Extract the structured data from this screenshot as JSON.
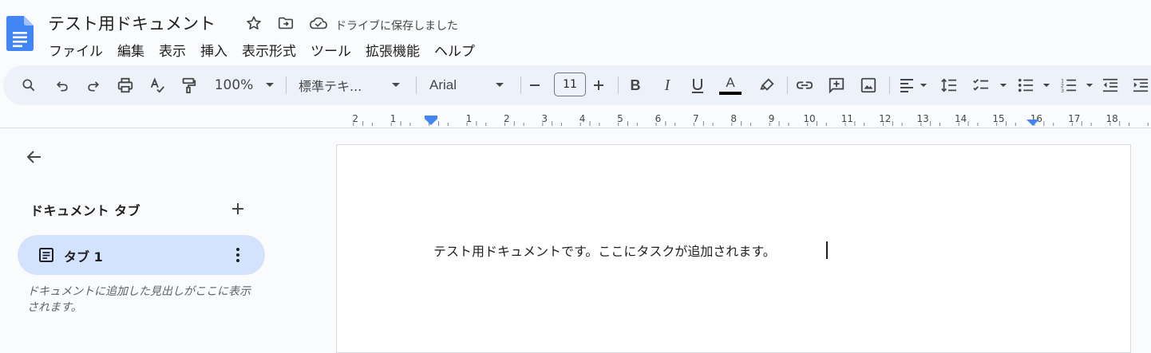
{
  "header": {
    "title": "テスト用ドキュメント",
    "save_status": "ドライブに保存しました",
    "menu": [
      "ファイル",
      "編集",
      "表示",
      "挿入",
      "表示形式",
      "ツール",
      "拡張機能",
      "ヘルプ"
    ]
  },
  "toolbar": {
    "zoom": "100%",
    "style": "標準テキ...",
    "font": "Arial",
    "font_size": "11",
    "icons": [
      "search-icon",
      "undo-icon",
      "redo-icon",
      "print-icon",
      "spellcheck-icon",
      "paint-format-icon",
      "bold-icon",
      "italic-icon",
      "underline-icon",
      "text-color-icon",
      "highlight-icon",
      "link-icon",
      "comment-icon",
      "image-icon",
      "align-left-icon",
      "line-spacing-icon",
      "checklist-icon",
      "bulleted-list-icon",
      "numbered-list-icon",
      "decrease-indent-icon",
      "increase-indent-icon"
    ],
    "colors": {
      "background": "#edf2fa",
      "text_color_bar": "#000000"
    }
  },
  "ruler": {
    "labels": [
      "2",
      "1",
      "1",
      "2",
      "3",
      "4",
      "5",
      "6",
      "7",
      "8",
      "9",
      "10",
      "11",
      "12",
      "13",
      "14",
      "15",
      "16",
      "17",
      "18"
    ],
    "marker_color": "#4285f4"
  },
  "sidebar": {
    "heading": "ドキュメント タブ",
    "tabs": [
      {
        "label": "タブ 1"
      }
    ],
    "hint": "ドキュメントに追加した見出しがここに表示されます。",
    "colors": {
      "selected_tab": "#d3e3fd"
    }
  },
  "document": {
    "text": "テスト用ドキュメントです。ここにタスクが追加されます。"
  },
  "colors": {
    "brand": "#4285f4"
  }
}
